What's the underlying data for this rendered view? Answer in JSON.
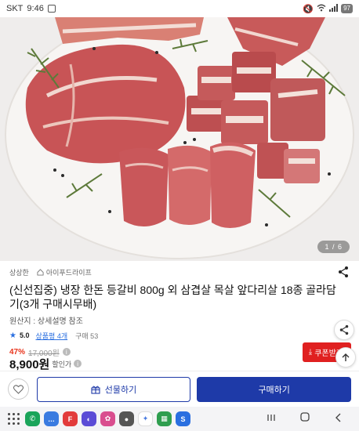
{
  "status_bar": {
    "carrier": "SKT",
    "time": "9:46",
    "battery": "97"
  },
  "hero": {
    "pager": "1 / 6",
    "colors": {
      "background": "#efedec",
      "plate": "#f6f4f2",
      "meat": "#c85a5a",
      "fat": "#f1d7d0",
      "herb": "#5d7a3a"
    }
  },
  "product": {
    "brand": "상상한",
    "store": "아이푸드라이프",
    "title": "(신선집중) 냉장 한돈 등갈비 800g 외 삼겹살 목살 앞다리살 18종 골라담기(3개 구매시무배)",
    "origin": "원산지 : 상세설명 참조",
    "rating": "5.0",
    "review_link": "상품평 4개",
    "purchase_count": "구매 53",
    "discount_rate": "47%",
    "original_price": "17,000원",
    "price": "8,900원",
    "price_note": "할인가",
    "coupon_label": "쿠폰받기"
  },
  "actions": {
    "gift_label": "선물하기",
    "buy_label": "구매하기"
  },
  "theme": {
    "accent": "#1e3aa8",
    "sale": "#e8341c",
    "coupon": "#e02020"
  },
  "dock_apps": [
    {
      "name": "phone-app-icon",
      "color": "#1aa45a",
      "glyph": "✆"
    },
    {
      "name": "messages-app-icon",
      "color": "#3a7be0",
      "glyph": "…"
    },
    {
      "name": "flipboard-app-icon",
      "color": "#e23b3b",
      "glyph": "F"
    },
    {
      "name": "browser-app-icon",
      "color": "#5b4cd6",
      "glyph": "◐"
    },
    {
      "name": "gallery-app-icon",
      "color": "#d94e8f",
      "glyph": "✿"
    },
    {
      "name": "camera-app-icon",
      "color": "#555555",
      "glyph": "●"
    },
    {
      "name": "gemini-app-icon",
      "color": "#ffffff",
      "glyph": "✦"
    },
    {
      "name": "multi-app-icon",
      "color": "#2f9e4f",
      "glyph": "▦"
    },
    {
      "name": "shop-app-icon",
      "color": "#2a6fe0",
      "glyph": "S"
    }
  ]
}
